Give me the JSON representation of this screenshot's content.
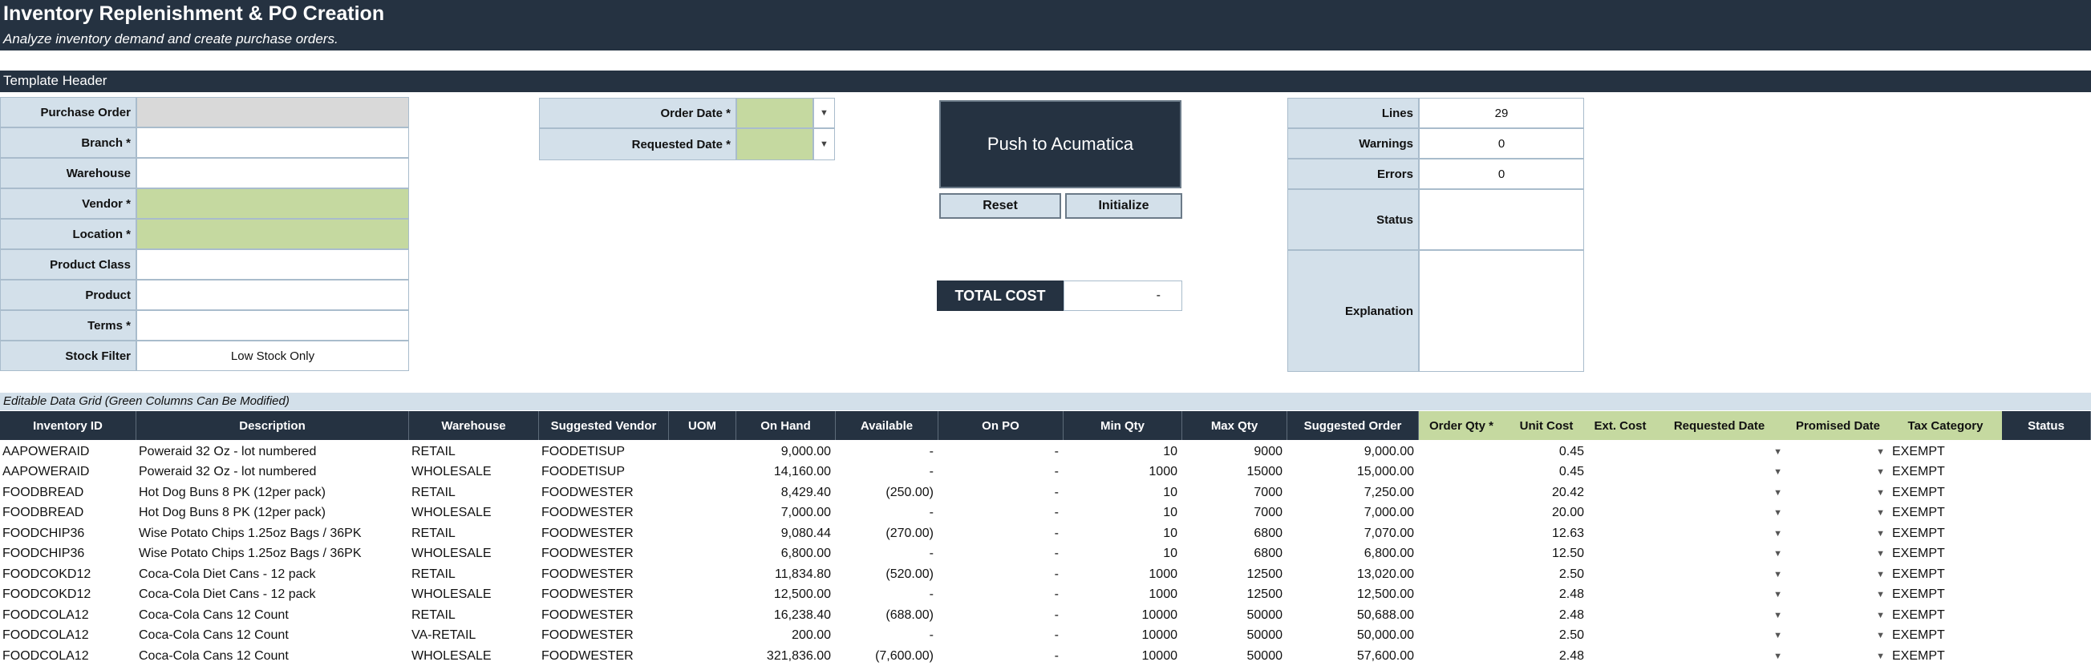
{
  "title": "Inventory Replenishment & PO Creation",
  "subtitle": "Analyze inventory demand and create purchase orders.",
  "section_header": "Template Header",
  "form": {
    "labels": {
      "purchase_order": "Purchase Order",
      "branch": "Branch *",
      "warehouse": "Warehouse",
      "vendor": "Vendor *",
      "location": "Location *",
      "product_class": "Product Class",
      "product": "Product",
      "terms": "Terms *",
      "stock_filter": "Stock Filter"
    },
    "stock_filter_value": "Low Stock Only",
    "order_date_label": "Order Date *",
    "requested_date_label": "Requested Date *"
  },
  "actions": {
    "push": "Push to Acumatica",
    "reset": "Reset",
    "initialize": "Initialize"
  },
  "total_cost": {
    "label": "TOTAL COST",
    "value": "-"
  },
  "summary": {
    "lines_label": "Lines",
    "lines": "29",
    "warnings_label": "Warnings",
    "warnings": "0",
    "errors_label": "Errors",
    "errors": "0",
    "status_label": "Status",
    "explanation_label": "Explanation"
  },
  "grid_caption": "Editable Data Grid (Green Columns Can Be Modified)",
  "grid": {
    "headers": [
      "Inventory ID",
      "Description",
      "Warehouse",
      "Suggested Vendor",
      "UOM",
      "On Hand",
      "Available",
      "On PO",
      "Min Qty",
      "Max Qty",
      "Suggested Order",
      "Order Qty *",
      "Unit Cost",
      "Ext. Cost",
      "Requested Date",
      "Promised Date",
      "Tax Category",
      "Status"
    ],
    "rows": [
      {
        "id": "AAPOWERAID",
        "desc": "Poweraid 32 Oz - lot numbered",
        "wh": "RETAIL",
        "vendor": "FOODETISUP",
        "onhand": "9,000.00",
        "avail": "-",
        "onpo": "-",
        "min": "10",
        "max": "9000",
        "sugg": "9,000.00",
        "cost": "0.45",
        "tax": "EXEMPT"
      },
      {
        "id": "AAPOWERAID",
        "desc": "Poweraid 32 Oz - lot numbered",
        "wh": "WHOLESALE",
        "vendor": "FOODETISUP",
        "onhand": "14,160.00",
        "avail": "-",
        "onpo": "-",
        "min": "1000",
        "max": "15000",
        "sugg": "15,000.00",
        "cost": "0.45",
        "tax": "EXEMPT"
      },
      {
        "id": "FOODBREAD",
        "desc": "Hot Dog Buns 8 PK (12per pack)",
        "wh": "RETAIL",
        "vendor": "FOODWESTER",
        "onhand": "8,429.40",
        "avail": "(250.00)",
        "onpo": "-",
        "min": "10",
        "max": "7000",
        "sugg": "7,250.00",
        "cost": "20.42",
        "tax": "EXEMPT"
      },
      {
        "id": "FOODBREAD",
        "desc": "Hot Dog Buns 8 PK (12per pack)",
        "wh": "WHOLESALE",
        "vendor": "FOODWESTER",
        "onhand": "7,000.00",
        "avail": "-",
        "onpo": "-",
        "min": "10",
        "max": "7000",
        "sugg": "7,000.00",
        "cost": "20.00",
        "tax": "EXEMPT"
      },
      {
        "id": "FOODCHIP36",
        "desc": "Wise Potato Chips 1.25oz Bags / 36PK",
        "wh": "RETAIL",
        "vendor": "FOODWESTER",
        "onhand": "9,080.44",
        "avail": "(270.00)",
        "onpo": "-",
        "min": "10",
        "max": "6800",
        "sugg": "7,070.00",
        "cost": "12.63",
        "tax": "EXEMPT"
      },
      {
        "id": "FOODCHIP36",
        "desc": "Wise Potato Chips 1.25oz Bags / 36PK",
        "wh": "WHOLESALE",
        "vendor": "FOODWESTER",
        "onhand": "6,800.00",
        "avail": "-",
        "onpo": "-",
        "min": "10",
        "max": "6800",
        "sugg": "6,800.00",
        "cost": "12.50",
        "tax": "EXEMPT"
      },
      {
        "id": "FOODCOKD12",
        "desc": "Coca-Cola Diet Cans - 12 pack",
        "wh": "RETAIL",
        "vendor": "FOODWESTER",
        "onhand": "11,834.80",
        "avail": "(520.00)",
        "onpo": "-",
        "min": "1000",
        "max": "12500",
        "sugg": "13,020.00",
        "cost": "2.50",
        "tax": "EXEMPT"
      },
      {
        "id": "FOODCOKD12",
        "desc": "Coca-Cola Diet Cans - 12 pack",
        "wh": "WHOLESALE",
        "vendor": "FOODWESTER",
        "onhand": "12,500.00",
        "avail": "-",
        "onpo": "-",
        "min": "1000",
        "max": "12500",
        "sugg": "12,500.00",
        "cost": "2.48",
        "tax": "EXEMPT"
      },
      {
        "id": "FOODCOLA12",
        "desc": "Coca-Cola Cans 12 Count",
        "wh": "RETAIL",
        "vendor": "FOODWESTER",
        "onhand": "16,238.40",
        "avail": "(688.00)",
        "onpo": "-",
        "min": "10000",
        "max": "50000",
        "sugg": "50,688.00",
        "cost": "2.48",
        "tax": "EXEMPT"
      },
      {
        "id": "FOODCOLA12",
        "desc": "Coca-Cola Cans 12 Count",
        "wh": "VA-RETAIL",
        "vendor": "FOODWESTER",
        "onhand": "200.00",
        "avail": "-",
        "onpo": "-",
        "min": "10000",
        "max": "50000",
        "sugg": "50,000.00",
        "cost": "2.50",
        "tax": "EXEMPT"
      },
      {
        "id": "FOODCOLA12",
        "desc": "Coca-Cola Cans 12 Count",
        "wh": "WHOLESALE",
        "vendor": "FOODWESTER",
        "onhand": "321,836.00",
        "avail": "(7,600.00)",
        "onpo": "-",
        "min": "10000",
        "max": "50000",
        "sugg": "57,600.00",
        "cost": "2.48",
        "tax": "EXEMPT"
      }
    ]
  },
  "colors": {
    "dark": "#253241",
    "label_bg": "#d3e0ea",
    "editable_green": "#c5d9a0"
  }
}
